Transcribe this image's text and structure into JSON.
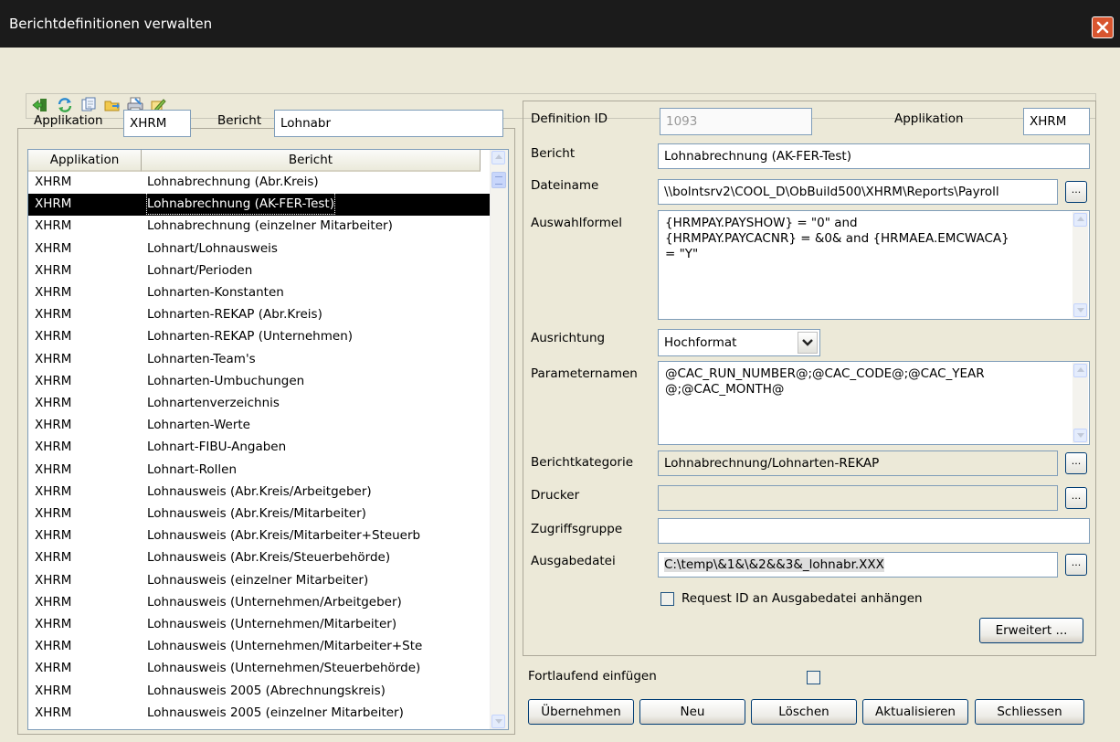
{
  "window": {
    "title": "Berichtdefinitionen verwalten"
  },
  "toolbar": {
    "icons": [
      "exit-icon",
      "refresh-icon",
      "copy-icon",
      "folder-export-icon",
      "print-icon",
      "edit-icon"
    ]
  },
  "filter": {
    "applikation_label": "Applikation",
    "applikation_value": "XHRM",
    "bericht_label": "Bericht",
    "bericht_value": "Lohnabr"
  },
  "list": {
    "columns": [
      "Applikation",
      "Bericht"
    ],
    "selected_index": 1,
    "rows": [
      {
        "app": "XHRM",
        "bericht": "Lohnabrechnung (Abr.Kreis)"
      },
      {
        "app": "XHRM",
        "bericht": "Lohnabrechnung (AK-FER-Test)"
      },
      {
        "app": "XHRM",
        "bericht": "Lohnabrechnung (einzelner Mitarbeiter)"
      },
      {
        "app": "XHRM",
        "bericht": "Lohnart/Lohnausweis"
      },
      {
        "app": "XHRM",
        "bericht": "Lohnart/Perioden"
      },
      {
        "app": "XHRM",
        "bericht": "Lohnarten-Konstanten"
      },
      {
        "app": "XHRM",
        "bericht": "Lohnarten-REKAP (Abr.Kreis)"
      },
      {
        "app": "XHRM",
        "bericht": "Lohnarten-REKAP (Unternehmen)"
      },
      {
        "app": "XHRM",
        "bericht": "Lohnarten-Team's"
      },
      {
        "app": "XHRM",
        "bericht": "Lohnarten-Umbuchungen"
      },
      {
        "app": "XHRM",
        "bericht": "Lohnartenverzeichnis"
      },
      {
        "app": "XHRM",
        "bericht": "Lohnarten-Werte"
      },
      {
        "app": "XHRM",
        "bericht": "Lohnart-FIBU-Angaben"
      },
      {
        "app": "XHRM",
        "bericht": "Lohnart-Rollen"
      },
      {
        "app": "XHRM",
        "bericht": "Lohnausweis (Abr.Kreis/Arbeitgeber)"
      },
      {
        "app": "XHRM",
        "bericht": "Lohnausweis (Abr.Kreis/Mitarbeiter)"
      },
      {
        "app": "XHRM",
        "bericht": "Lohnausweis (Abr.Kreis/Mitarbeiter+Steuerb"
      },
      {
        "app": "XHRM",
        "bericht": "Lohnausweis (Abr.Kreis/Steuerbehörde)"
      },
      {
        "app": "XHRM",
        "bericht": "Lohnausweis (einzelner Mitarbeiter)"
      },
      {
        "app": "XHRM",
        "bericht": "Lohnausweis (Unternehmen/Arbeitgeber)"
      },
      {
        "app": "XHRM",
        "bericht": "Lohnausweis (Unternehmen/Mitarbeiter)"
      },
      {
        "app": "XHRM",
        "bericht": "Lohnausweis (Unternehmen/Mitarbeiter+Ste"
      },
      {
        "app": "XHRM",
        "bericht": "Lohnausweis (Unternehmen/Steuerbehörde)"
      },
      {
        "app": "XHRM",
        "bericht": "Lohnausweis 2005 (Abrechnungskreis)"
      },
      {
        "app": "XHRM",
        "bericht": "Lohnausweis 2005 (einzelner Mitarbeiter)"
      }
    ]
  },
  "detail": {
    "definition_id_label": "Definition ID",
    "definition_id_value": "1093",
    "applikation_label": "Applikation",
    "applikation_value": "XHRM",
    "bericht_label": "Bericht",
    "bericht_value": "Lohnabrechnung (AK-FER-Test)",
    "dateiname_label": "Dateiname",
    "dateiname_value": "\\\\bolntsrv2\\COOL_D\\ObBuild500\\XHRM\\Reports\\Payroll",
    "auswahlformel_label": "Auswahlformel",
    "auswahlformel_value": "{HRMPAY.PAYSHOW} = \"0\" and\n{HRMPAY.PAYCACNR} = &0& and {HRMAEA.EMCWACA}\n= \"Y\"",
    "ausrichtung_label": "Ausrichtung",
    "ausrichtung_value": "Hochformat",
    "parameternamen_label": "Parameternamen",
    "parameternamen_value": "@CAC_RUN_NUMBER@;@CAC_CODE@;@CAC_YEAR\n@;@CAC_MONTH@",
    "berichtkategorie_label": "Berichtkategorie",
    "berichtkategorie_value": "Lohnabrechnung/Lohnarten-REKAP",
    "drucker_label": "Drucker",
    "drucker_value": "",
    "zugriffsgruppe_label": "Zugriffsgruppe",
    "zugriffsgruppe_value": "",
    "ausgabedatei_label": "Ausgabedatei",
    "ausgabedatei_value": "C:\\temp\\&1&\\&2&&3&_lohnabr.XXX",
    "request_id_label": "Request ID an Ausgabedatei anhängen",
    "request_id_checked": false,
    "erweitert_label": "Erweitert ...",
    "browse_label": "..."
  },
  "footer": {
    "fortlaufend_label": "Fortlaufend einfügen",
    "fortlaufend_checked": false,
    "buttons": [
      "Übernehmen",
      "Neu",
      "Löschen",
      "Aktualisieren",
      "Schliessen"
    ]
  }
}
